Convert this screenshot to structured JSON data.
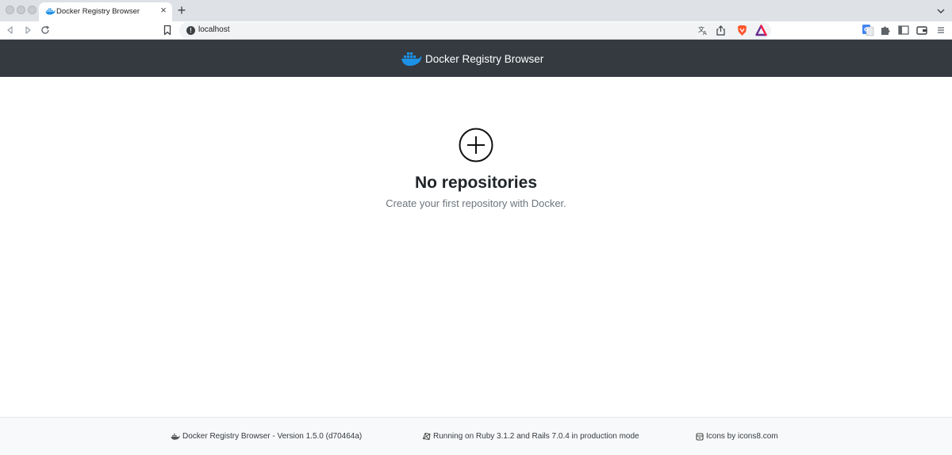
{
  "browser": {
    "tab": {
      "title": "Docker Registry Browser",
      "favicon": "docker-whale-icon"
    },
    "address": {
      "url": "localhost"
    },
    "icons": [
      "back-arrow-icon",
      "forward-arrow-icon",
      "reload-icon",
      "bookmark-icon",
      "info-icon",
      "translate-icon",
      "share-icon",
      "brave-shields-icon",
      "brave-rewards-icon",
      "google-translate-extension-icon",
      "puzzle-extensions-icon",
      "sidebar-toggle-icon",
      "wallet-icon",
      "menu-icon"
    ]
  },
  "header": {
    "brand": "Docker Registry Browser",
    "logo": "docker-whale-icon",
    "background": "#343a40"
  },
  "empty_state": {
    "icon": "plus-circle-icon",
    "title": "No repositories",
    "subtitle": "Create your first repository with Docker."
  },
  "footer": {
    "version": "Docker Registry Browser - Version 1.5.0 (d70464a)",
    "runtime": "Running on Ruby 3.1.2 and Rails 7.0.4 in production mode",
    "credits": "Icons by icons8.com"
  },
  "colors": {
    "docker_blue": "#1d91e6",
    "brave_orange": "#fb542b",
    "header_bg": "#343a40"
  }
}
